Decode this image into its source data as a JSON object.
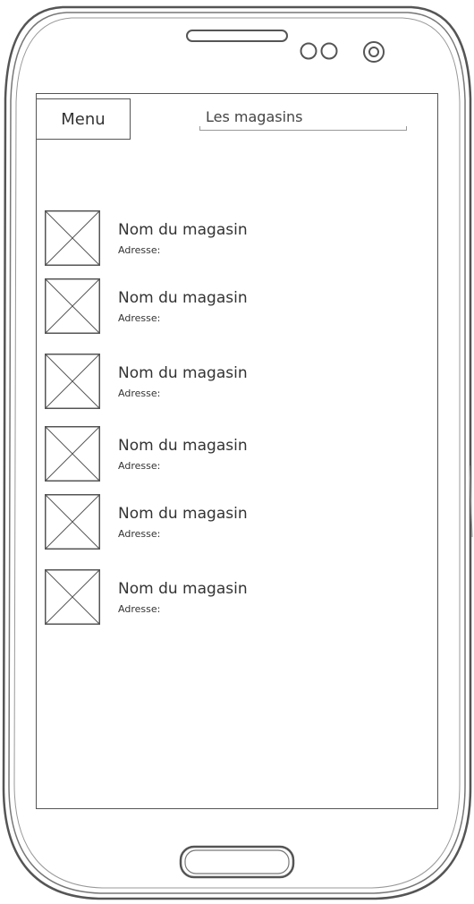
{
  "header": {
    "menu_label": "Menu",
    "title": "Les magasins"
  },
  "stores": [
    {
      "name": "Nom du magasin",
      "address_label": "Adresse:"
    },
    {
      "name": "Nom du magasin",
      "address_label": "Adresse:"
    },
    {
      "name": "Nom du magasin",
      "address_label": "Adresse:"
    },
    {
      "name": "Nom du magasin",
      "address_label": "Adresse:"
    },
    {
      "name": "Nom du magasin",
      "address_label": "Adresse:"
    },
    {
      "name": "Nom du magasin",
      "address_label": "Adresse:"
    }
  ],
  "device": {
    "icons": [
      "speaker-icon",
      "camera-icon",
      "sensor-icon",
      "home-button-icon"
    ]
  },
  "colors": {
    "outline": "#555555",
    "field_underline": "#999999",
    "text": "#333333"
  }
}
